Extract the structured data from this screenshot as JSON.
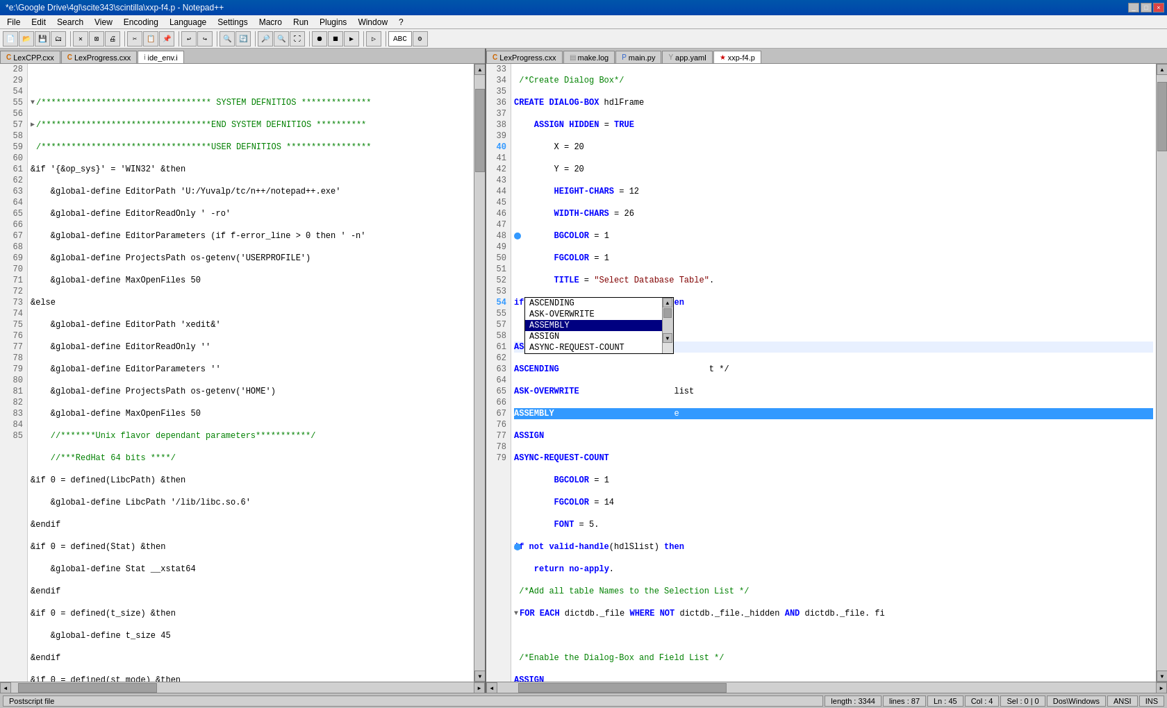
{
  "titleBar": {
    "title": "*e:\\Google Drive\\4gl\\scite343\\scintilla\\xxp-f4.p - Notepad++",
    "minimizeLabel": "_",
    "maximizeLabel": "□",
    "closeLabel": "×"
  },
  "menuBar": {
    "items": [
      "File",
      "Edit",
      "Search",
      "View",
      "Encoding",
      "Language",
      "Settings",
      "Macro",
      "Run",
      "Plugins",
      "Window",
      "?"
    ]
  },
  "leftPanel": {
    "tabs": [
      {
        "label": "LexCPP.cxx",
        "active": false
      },
      {
        "label": "LexProgress.cxx",
        "active": false
      },
      {
        "label": "ide_env.i",
        "active": true
      }
    ]
  },
  "rightPanel": {
    "tabs": [
      {
        "label": "LexProgress.cxx",
        "active": false
      },
      {
        "label": "make.log",
        "active": false
      },
      {
        "label": "main.py",
        "active": false
      },
      {
        "label": "app.yaml",
        "active": false
      },
      {
        "label": "xxp-f4.p",
        "active": true
      }
    ]
  },
  "autocomplete": {
    "items": [
      {
        "label": "ASCENDING",
        "selected": false
      },
      {
        "label": "ASK-OVERWRITE",
        "selected": false
      },
      {
        "label": "ASSEMBLY",
        "selected": true
      },
      {
        "label": "ASSIGN",
        "selected": false
      },
      {
        "label": "ASYNC-REQUEST-COUNT",
        "selected": false
      }
    ]
  },
  "statusBar": {
    "leftLabel": "Postscript file",
    "length": "length : 3344",
    "lines": "lines : 87",
    "ln": "Ln : 45",
    "col": "Col : 4",
    "sel": "Sel : 0 | 0",
    "dosWindows": "Dos\\Windows",
    "ansi": "ANSI",
    "ins": "INS"
  }
}
